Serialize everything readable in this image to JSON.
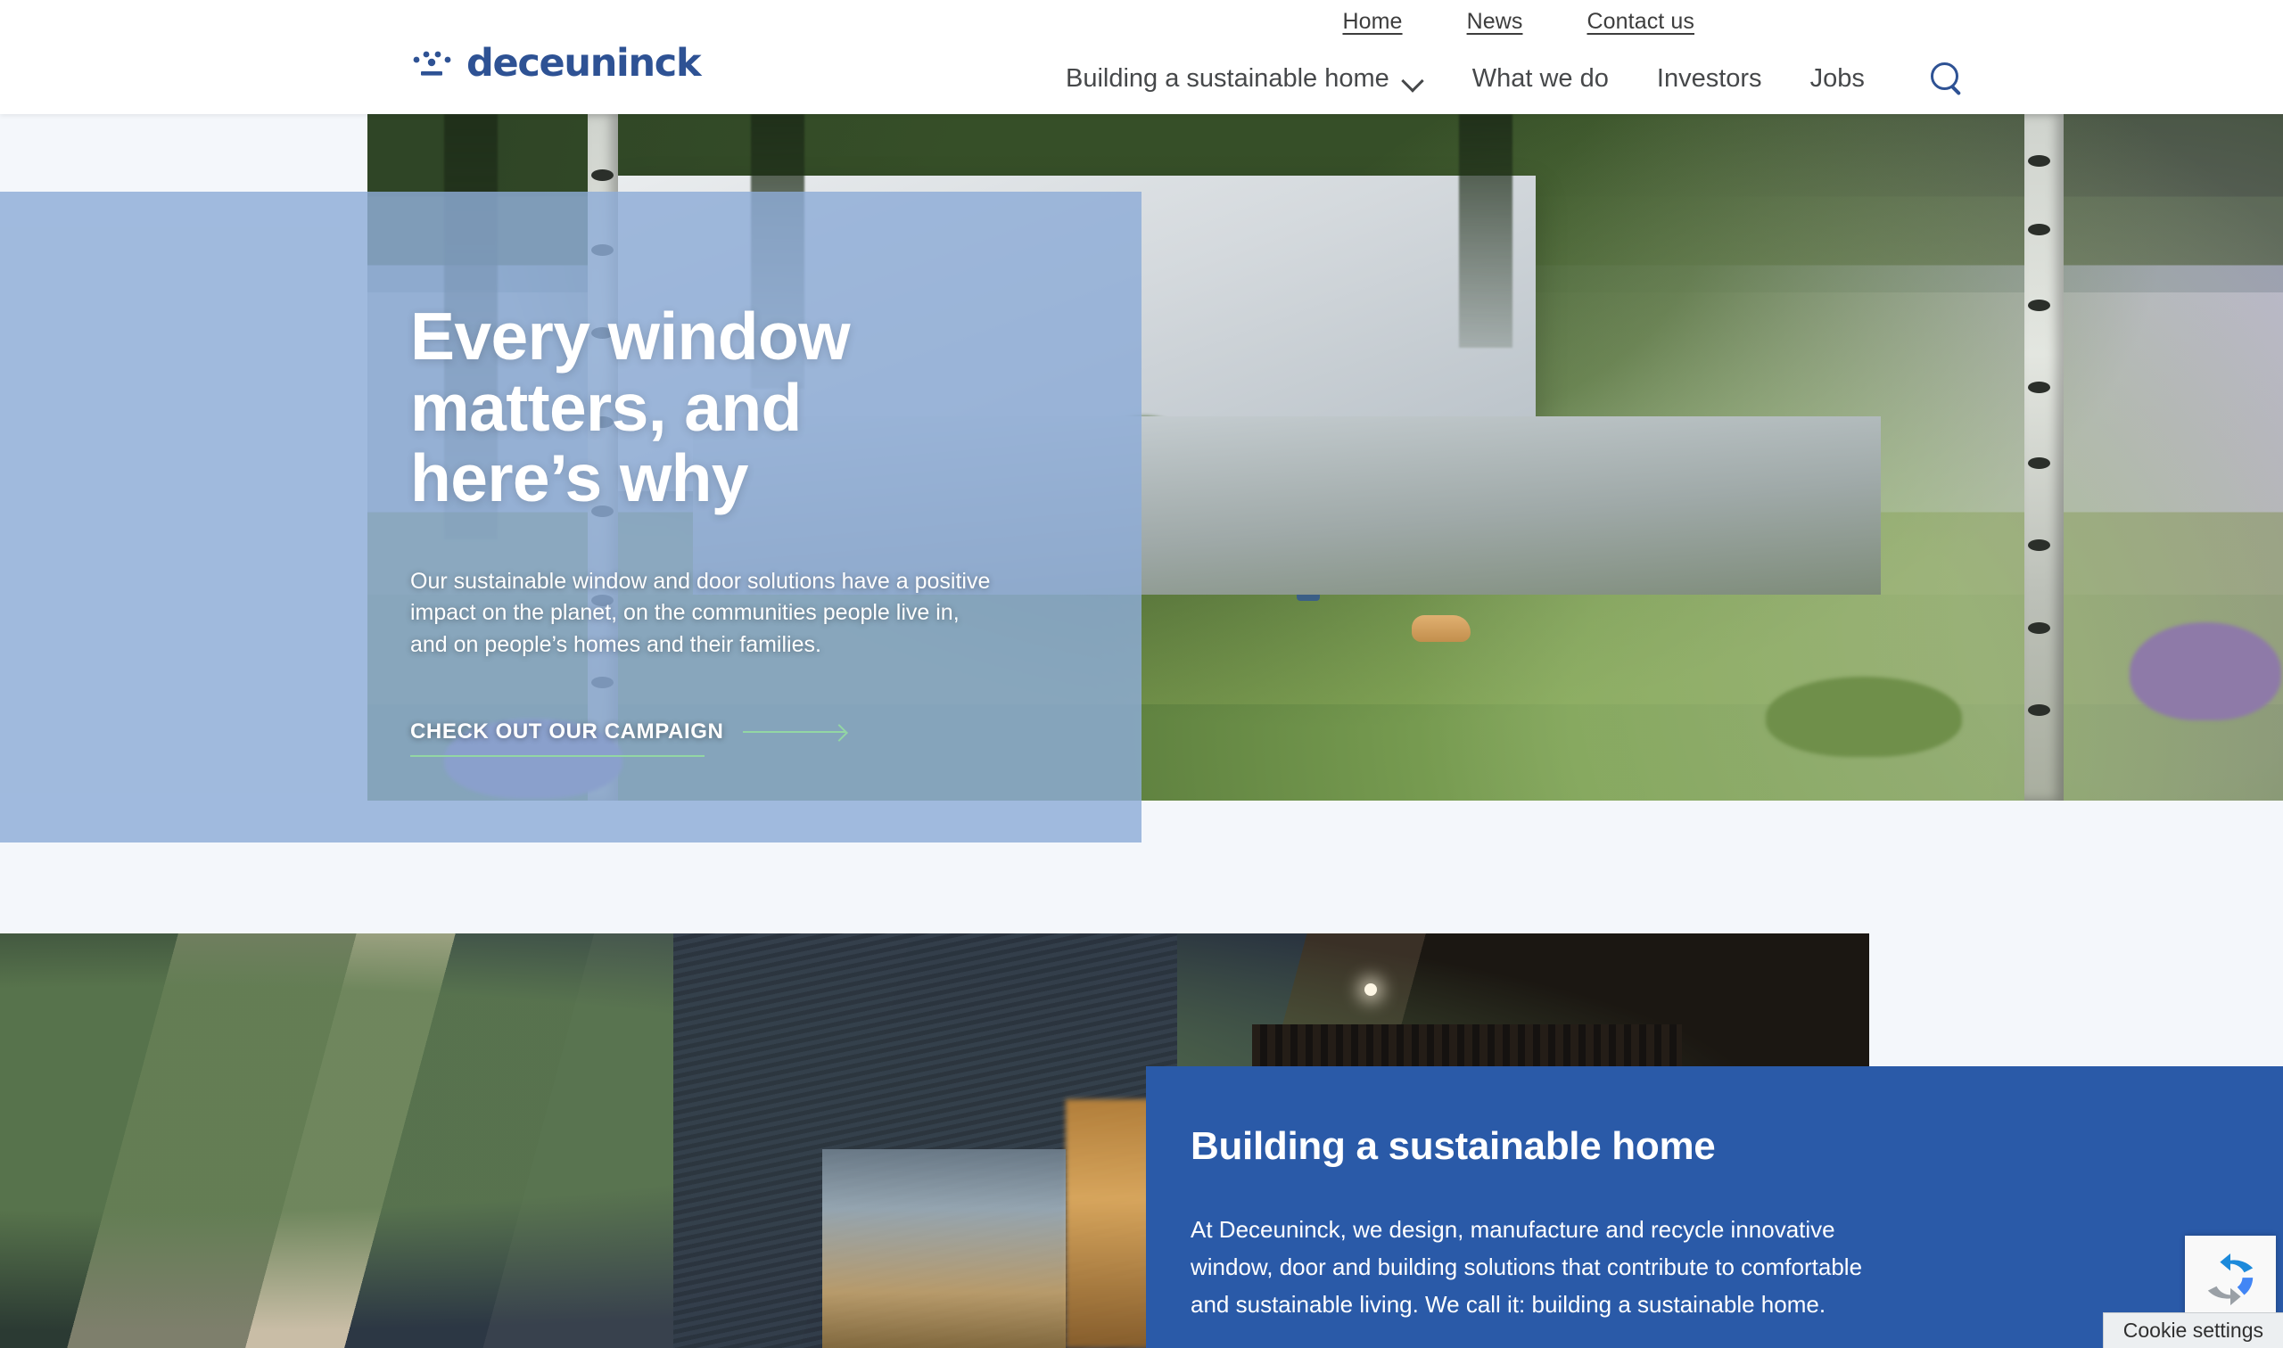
{
  "header": {
    "utility_nav": [
      {
        "label": "Home"
      },
      {
        "label": "News"
      },
      {
        "label": "Contact us"
      }
    ],
    "logo": {
      "text": "deceuninck",
      "icon": "deceuninck-dots-logo"
    },
    "main_nav": [
      {
        "label": "Building a sustainable home",
        "has_dropdown": true
      },
      {
        "label": "What we do",
        "has_dropdown": false
      },
      {
        "label": "Investors",
        "has_dropdown": false
      },
      {
        "label": "Jobs",
        "has_dropdown": false
      }
    ],
    "search": {
      "icon": "search-icon"
    }
  },
  "hero": {
    "title": "Every window matters, and here’s why",
    "subtitle": "Our sustainable window and door solutions have a positive impact on the planet, on the communities people live in, and on people’s homes and their families.",
    "cta_label": "CHECK OUT OUR CAMPAIGN",
    "cta_arrow_icon": "arrow-right-icon"
  },
  "section_two": {
    "title": "Building a sustainable home",
    "text": "At Deceuninck, we design, manufacture and recycle innovative window, door and building solutions that contribute to comfortable and sustainable living. We call it: building a sustainable home."
  },
  "widgets": {
    "recaptcha_icon": "recaptcha-icon",
    "cookie_settings_label": "Cookie settings"
  },
  "colors": {
    "brand_blue": "#2e5294",
    "panel_blue": "#2a5aa8",
    "hero_tint": "#8dacd7",
    "accent_green": "#93d6a4",
    "page_background": "#f4f7fb"
  }
}
